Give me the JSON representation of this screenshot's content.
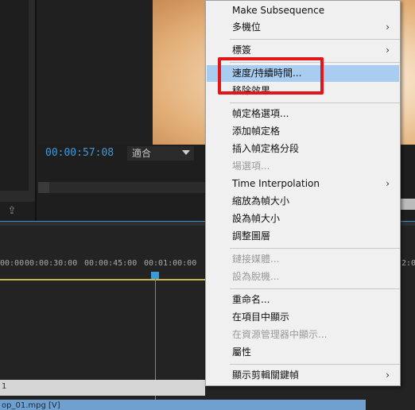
{
  "monitor": {
    "timecode": "00:00:57:08",
    "fit_value": "適合"
  },
  "timeline": {
    "ruler": [
      "00:00",
      "00:00:30:00",
      "00:00:45:00",
      "00:01:00:00",
      "2:0"
    ],
    "track_label": "1",
    "clip_label": "op_01.mpg [V]"
  },
  "menu": {
    "items": [
      {
        "label": "Make Subsequence",
        "enabled": true
      },
      {
        "label": "多機位",
        "enabled": true,
        "submenu": true
      },
      {
        "label": "標簽",
        "enabled": true,
        "submenu": true
      },
      {
        "label": "速度/持續時間...",
        "enabled": true,
        "highlighted": true
      },
      {
        "label": "移除效果",
        "enabled": true
      },
      {
        "label": "幀定格選項...",
        "enabled": true
      },
      {
        "label": "添加幀定格",
        "enabled": true
      },
      {
        "label": "插入幀定格分段",
        "enabled": true
      },
      {
        "label": "場選項...",
        "enabled": false
      },
      {
        "label": "Time Interpolation",
        "enabled": true,
        "submenu": true
      },
      {
        "label": "縮放為幀大小",
        "enabled": true
      },
      {
        "label": "設為幀大小",
        "enabled": true
      },
      {
        "label": "調整圖層",
        "enabled": true
      },
      {
        "label": "鏈接媒體...",
        "enabled": false
      },
      {
        "label": "設為脫機...",
        "enabled": false
      },
      {
        "label": "重命名...",
        "enabled": true
      },
      {
        "label": "在項目中顯示",
        "enabled": true
      },
      {
        "label": "在資源管理器中顯示...",
        "enabled": false
      },
      {
        "label": "屬性",
        "enabled": true
      },
      {
        "label": "顯示剪輯關鍵幀",
        "enabled": true,
        "submenu": true
      }
    ],
    "submenu_arrow": "›"
  },
  "colors": {
    "accent_blue": "#3b9ad9",
    "highlight": "#a9cdf0",
    "annotation_red": "#e0161a"
  }
}
